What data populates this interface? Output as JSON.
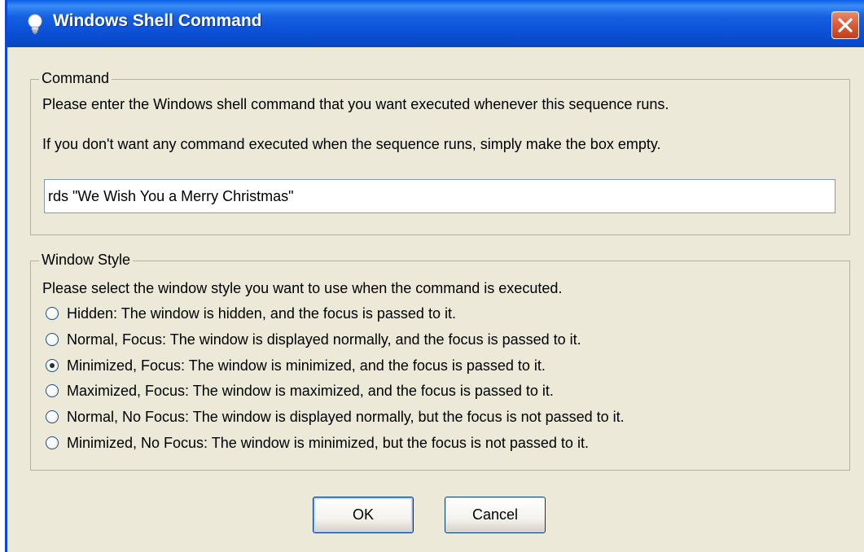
{
  "window": {
    "title": "Windows Shell Command",
    "close_symbol": "✕"
  },
  "command_group": {
    "legend": "Command",
    "instruction_1": "Please enter the Windows shell command that you want executed whenever this sequence runs.",
    "instruction_2": "If you don't want any command executed when the sequence runs, simply make the box empty.",
    "command_value": "rds \"We Wish You a Merry Christmas\""
  },
  "style_group": {
    "legend": "Window Style",
    "instruction": "Please select the window style you want to use when the command is executed.",
    "options": [
      {
        "label": "Hidden: The window is hidden, and the focus is passed to it.",
        "checked": false
      },
      {
        "label": "Normal, Focus: The window is displayed normally, and the focus is passed to it.",
        "checked": false
      },
      {
        "label": "Minimized, Focus: The window is minimized, and the focus is passed to it.",
        "checked": true
      },
      {
        "label": "Maximized, Focus: The window is maximized, and the focus is passed to it.",
        "checked": false
      },
      {
        "label": "Normal, No Focus: The window is displayed normally, but the focus is not passed to it.",
        "checked": false
      },
      {
        "label": "Minimized, No Focus: The window is minimized, but the focus is not passed to it.",
        "checked": false
      }
    ]
  },
  "buttons": {
    "ok_label": "OK",
    "cancel_label": "Cancel"
  },
  "colors": {
    "titlebar": "#0b4fd4",
    "dialog_bg": "#ece9d8",
    "close_button": "#d85a36"
  },
  "icons": {
    "title": "lightbulb-icon",
    "close": "close-icon"
  }
}
